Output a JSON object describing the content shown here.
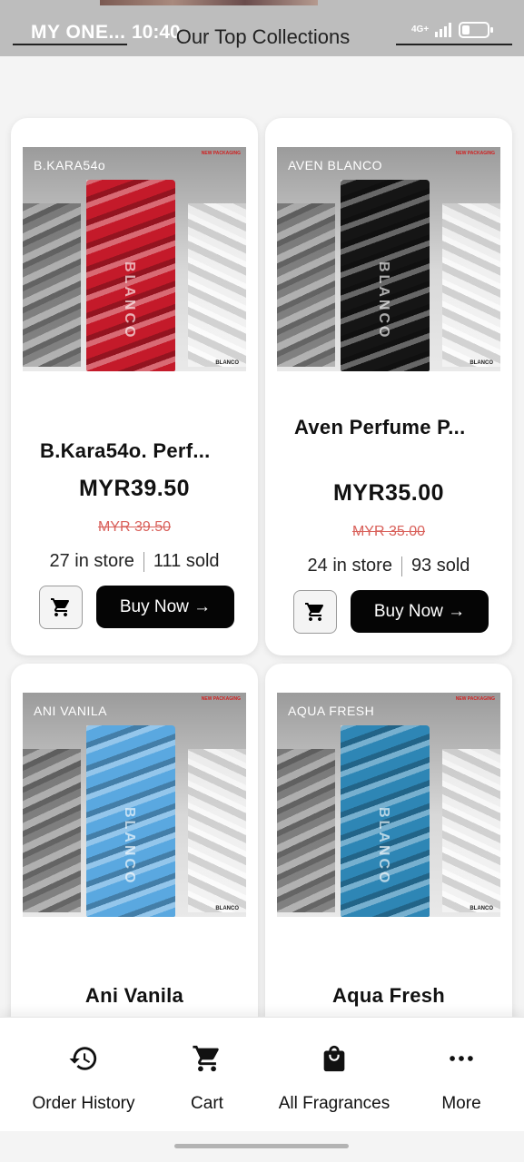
{
  "status_bar": {
    "carrier": "MY ONE...",
    "time": "10:40",
    "network": "4G+"
  },
  "header": {
    "title": "Our Top Collections"
  },
  "products": [
    {
      "image_brand": "B.KARA54o",
      "image_tag": "NEW PACKAGING",
      "bottle_word": "BLANCO",
      "image_logo": "BLANCO",
      "bottle_color": "#c41a2a",
      "name": "B.Kara54o. Perf...",
      "price": "MYR39.50",
      "old_price": "MYR 39.50",
      "stock": "27 in store",
      "sold": "111 sold",
      "buy_label": "Buy Now →"
    },
    {
      "image_brand": "AVEN BLANCO",
      "image_tag": "NEW PACKAGING",
      "bottle_word": "BLANCO",
      "image_logo": "BLANCO",
      "bottle_color": "#151515",
      "name": "Aven  Perfume P...",
      "price": "MYR35.00",
      "old_price": "MYR 35.00",
      "stock": "24 in store",
      "sold": "93 sold",
      "buy_label": "Buy Now →"
    },
    {
      "image_brand": "ANI VANILA",
      "image_tag": "NEW PACKAGING",
      "bottle_word": "BLANCO",
      "image_logo": "BLANCO",
      "bottle_color": "#5aa8e0",
      "name": "Ani Vanila"
    },
    {
      "image_brand": "AQUA FRESH",
      "image_tag": "NEW PACKAGING",
      "bottle_word": "BLANCO",
      "image_logo": "BLANCO",
      "bottle_color": "#2e86b5",
      "name": "Aqua Fresh"
    }
  ],
  "bottom_nav": [
    {
      "label": "Order History",
      "icon": "history-icon"
    },
    {
      "label": "Cart",
      "icon": "cart-icon"
    },
    {
      "label": "All Fragrances",
      "icon": "shopping-bag-icon"
    },
    {
      "label": "More",
      "icon": "more-dots-icon"
    }
  ],
  "colors": {
    "primary_button": "#050505",
    "old_price": "#d9615b",
    "header_bg": "#bdbdbd"
  }
}
